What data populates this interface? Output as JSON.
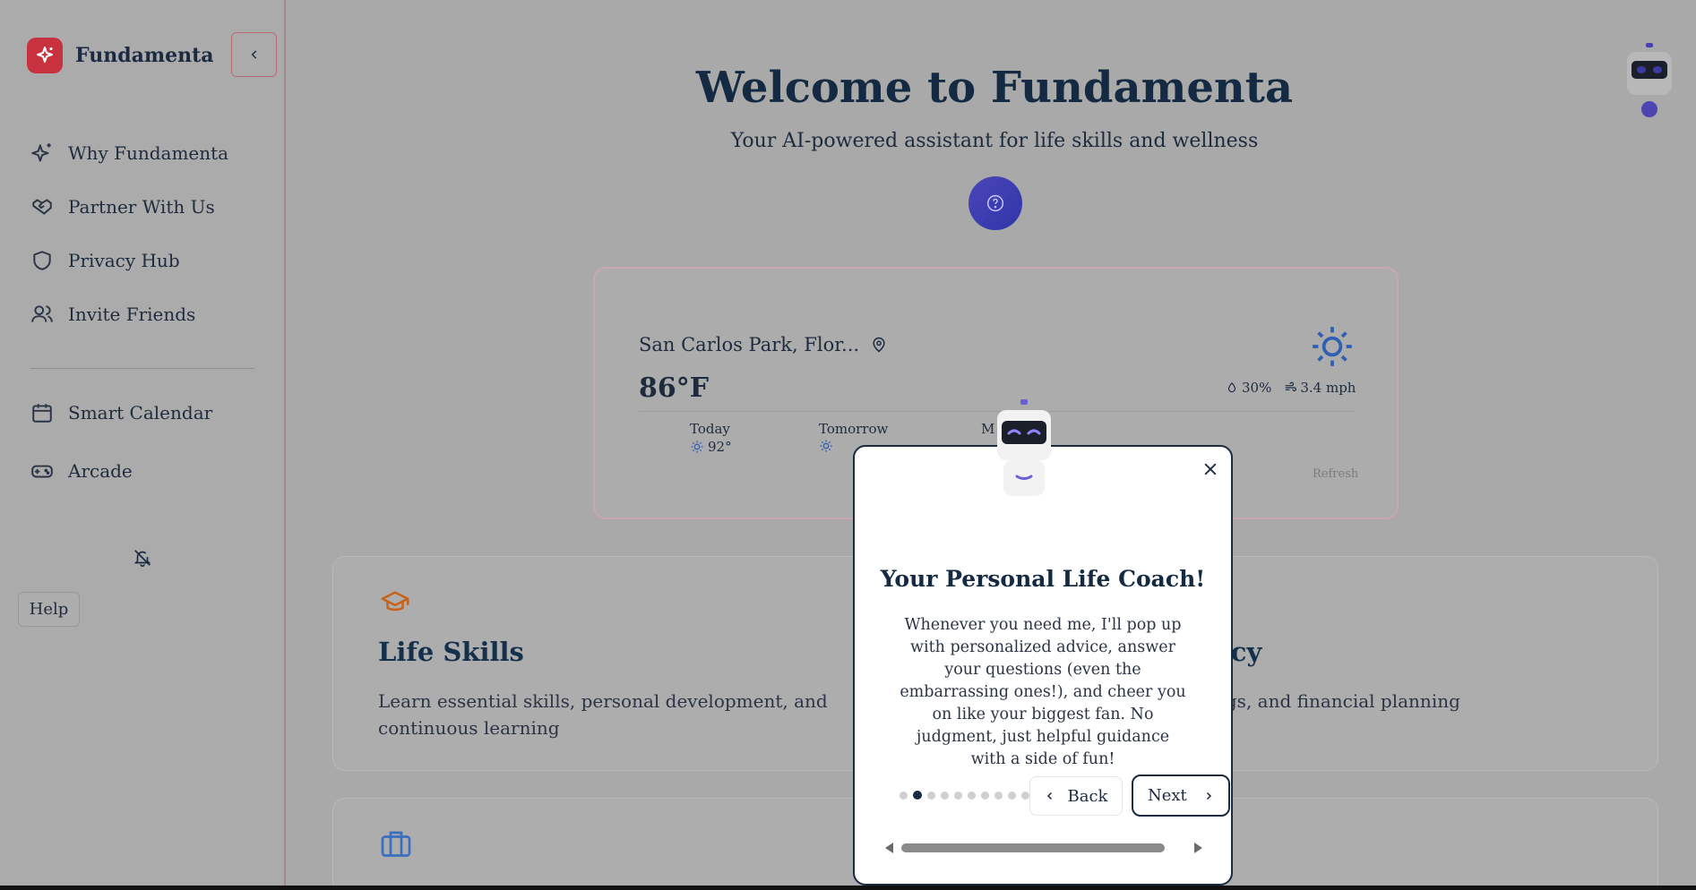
{
  "sidebar": {
    "brand": "Fundamenta",
    "items": [
      {
        "label": "Why Fundamenta",
        "icon": "sparkles-icon"
      },
      {
        "label": "Partner With Us",
        "icon": "handshake-icon"
      },
      {
        "label": "Privacy Hub",
        "icon": "shield-icon"
      },
      {
        "label": "Invite Friends",
        "icon": "users-icon"
      },
      {
        "label": "Smart Calendar",
        "icon": "calendar-icon"
      },
      {
        "label": "Arcade",
        "icon": "gamepad-icon"
      }
    ],
    "help_label": "Help"
  },
  "main": {
    "title": "Welcome to Fundamenta",
    "subtitle": "Your AI-powered assistant for life skills and wellness"
  },
  "weather": {
    "location": "San Carlos Park, Flor...",
    "temperature": "86°F",
    "humidity": "30%",
    "wind": "3.4 mph",
    "days": [
      {
        "name": "Today",
        "high": "92°"
      },
      {
        "name": "Tomorrow",
        "high": ""
      },
      {
        "name": "M",
        "high": ""
      }
    ],
    "refresh_label": "Refresh"
  },
  "cards": [
    {
      "title": "Life Skills",
      "description": "Learn essential skills, personal development, and continuous learning",
      "icon": "graduation-cap-icon"
    },
    {
      "title": "acy",
      "description": "ngs, and financial planning"
    },
    {
      "title": "",
      "icon": "briefcase-icon"
    }
  ],
  "modal": {
    "title": "Your Personal Life Coach!",
    "body": "Whenever you need me, I'll pop up with personalized advice, answer your questions (even the embarrassing ones!), and cheer you on like your biggest fan. No judgment, just helpful guidance with a side of fun!",
    "back_label": "Back",
    "next_label": "Next",
    "step_count": 10,
    "current_step": 2
  },
  "colors": {
    "accent": "#c8323f",
    "navy": "#132a42",
    "orange": "#c8621a",
    "blue": "#3a6fc0",
    "robot_purple": "#6a5acd"
  }
}
